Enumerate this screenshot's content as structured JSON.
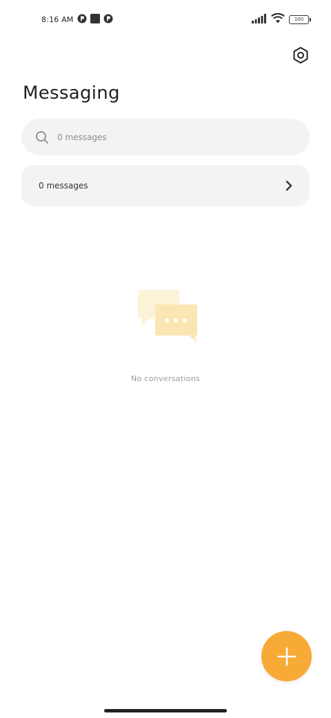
{
  "status_bar": {
    "time": "8:16 AM",
    "battery": "100"
  },
  "header": {
    "title": "Messaging",
    "settings_icon": "gear-icon"
  },
  "search": {
    "placeholder": "0 messages"
  },
  "messages_row": {
    "label": "0 messages"
  },
  "empty_state": {
    "text": "No conversations"
  },
  "colors": {
    "accent": "#f7ab36",
    "panel_bg": "#f3f3f3",
    "illustration_light": "#fdf3d9",
    "illustration_dark": "#fbe6b3"
  },
  "fab": {
    "icon": "plus-icon"
  }
}
